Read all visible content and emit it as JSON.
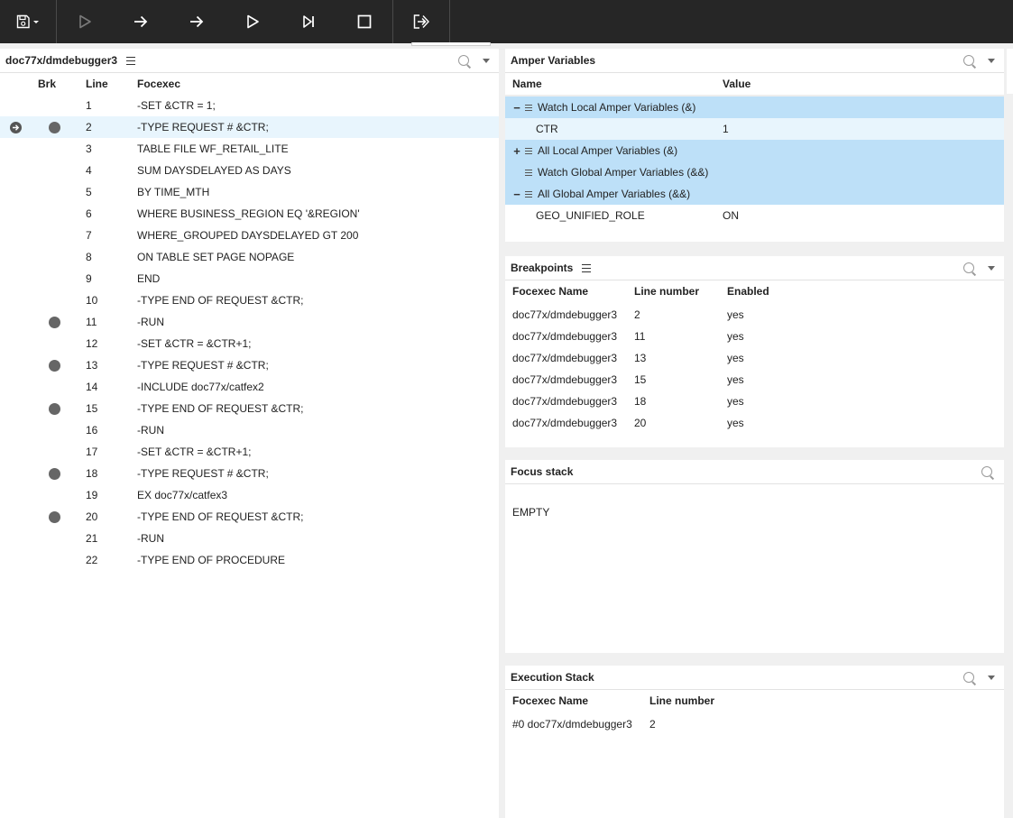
{
  "toolbar": {
    "buttons": [
      {
        "name": "save",
        "icon": "save-icon",
        "enabled": true
      },
      {
        "name": "run",
        "icon": "play-outline-icon",
        "enabled": false
      },
      {
        "name": "step-over",
        "icon": "arrow-right-icon",
        "enabled": true
      },
      {
        "name": "step-into",
        "icon": "arrow-right-icon",
        "enabled": true
      },
      {
        "name": "continue",
        "icon": "play-outline-icon",
        "enabled": true
      },
      {
        "name": "run-to-next",
        "icon": "skip-next-icon",
        "enabled": true
      },
      {
        "name": "stop",
        "icon": "stop-icon",
        "enabled": true
      },
      {
        "name": "exit",
        "icon": "exit-icon",
        "enabled": true
      }
    ]
  },
  "source": {
    "title": "doc77x/dmdebugger3",
    "columns": {
      "brk": "Brk",
      "line": "Line",
      "code": "Focexec"
    },
    "current_line": 2,
    "lines": [
      {
        "n": "1",
        "code": "-SET &CTR = 1;",
        "bp": false
      },
      {
        "n": "2",
        "code": "-TYPE REQUEST # &CTR;",
        "bp": true
      },
      {
        "n": "3",
        "code": "TABLE FILE WF_RETAIL_LITE",
        "bp": false
      },
      {
        "n": "4",
        "code": "SUM DAYSDELAYED AS DAYS",
        "bp": false
      },
      {
        "n": "5",
        "code": "BY TIME_MTH",
        "bp": false
      },
      {
        "n": "6",
        "code": "WHERE BUSINESS_REGION EQ '&REGION'",
        "bp": false
      },
      {
        "n": "7",
        "code": "WHERE_GROUPED DAYSDELAYED GT 200",
        "bp": false
      },
      {
        "n": "8",
        "code": "ON TABLE SET PAGE NOPAGE",
        "bp": false
      },
      {
        "n": "9",
        "code": "END",
        "bp": false
      },
      {
        "n": "10",
        "code": "-TYPE END OF REQUEST &CTR;",
        "bp": false
      },
      {
        "n": "11",
        "code": "-RUN",
        "bp": true
      },
      {
        "n": "12",
        "code": "-SET &CTR = &CTR+1;",
        "bp": false
      },
      {
        "n": "13",
        "code": "-TYPE REQUEST # &CTR;",
        "bp": true
      },
      {
        "n": "14",
        "code": "-INCLUDE doc77x/catfex2",
        "bp": false
      },
      {
        "n": "15",
        "code": "-TYPE END OF REQUEST &CTR;",
        "bp": true
      },
      {
        "n": "16",
        "code": "-RUN",
        "bp": false
      },
      {
        "n": "17",
        "code": "-SET &CTR = &CTR+1;",
        "bp": false
      },
      {
        "n": "18",
        "code": "-TYPE REQUEST # &CTR;",
        "bp": true
      },
      {
        "n": "19",
        "code": "EX doc77x/catfex3",
        "bp": false
      },
      {
        "n": "20",
        "code": "-TYPE END OF REQUEST &CTR;",
        "bp": true
      },
      {
        "n": "21",
        "code": "-RUN",
        "bp": false
      },
      {
        "n": "22",
        "code": "-TYPE END OF PROCEDURE",
        "bp": false
      }
    ]
  },
  "amper": {
    "title": "Amper Variables",
    "columns": {
      "name": "Name",
      "value": "Value"
    },
    "rows": [
      {
        "kind": "group",
        "toggle": "−",
        "label": "Watch Local Amper Variables (&)"
      },
      {
        "kind": "var",
        "name": "CTR",
        "value": "1"
      },
      {
        "kind": "group",
        "toggle": "+",
        "label": "All Local Amper Variables (&)"
      },
      {
        "kind": "group",
        "toggle": "",
        "label": "Watch Global Amper Variables (&&)"
      },
      {
        "kind": "group",
        "toggle": "−",
        "label": "All Global Amper Variables (&&)"
      },
      {
        "kind": "var",
        "name": "GEO_UNIFIED_ROLE",
        "value": "ON"
      }
    ]
  },
  "breakpoints": {
    "title": "Breakpoints",
    "columns": {
      "name": "Focexec Name",
      "line": "Line number",
      "enabled": "Enabled"
    },
    "rows": [
      {
        "name": "doc77x/dmdebugger3",
        "line": "2",
        "enabled": "yes"
      },
      {
        "name": "doc77x/dmdebugger3",
        "line": "11",
        "enabled": "yes"
      },
      {
        "name": "doc77x/dmdebugger3",
        "line": "13",
        "enabled": "yes"
      },
      {
        "name": "doc77x/dmdebugger3",
        "line": "15",
        "enabled": "yes"
      },
      {
        "name": "doc77x/dmdebugger3",
        "line": "18",
        "enabled": "yes"
      },
      {
        "name": "doc77x/dmdebugger3",
        "line": "20",
        "enabled": "yes"
      }
    ]
  },
  "focus_stack": {
    "title": "Focus stack",
    "content": "EMPTY"
  },
  "execution_stack": {
    "title": "Execution Stack",
    "columns": {
      "name": "Focexec Name",
      "line": "Line number"
    },
    "rows": [
      {
        "name": "#0 doc77x/dmdebugger3",
        "line": "2"
      }
    ]
  }
}
